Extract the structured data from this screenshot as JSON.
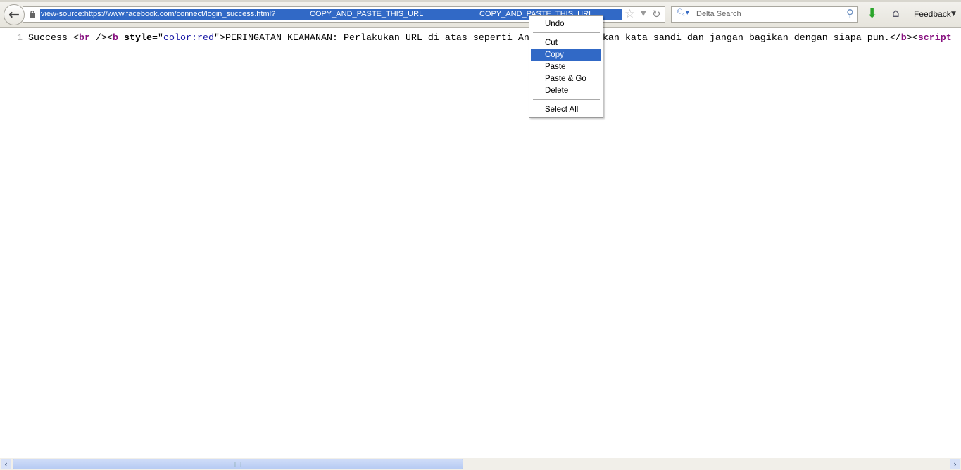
{
  "toolbar": {
    "url_prefix": "view-source:https://www.facebook.com/connect/login_success.html?",
    "url_token1": "COPY_AND_PASTE_THIS_URL",
    "url_token2": "COPY_AND_PASTE_THIS_URL",
    "search_placeholder": "Delta Search",
    "feedback_label": "Feedback"
  },
  "source": {
    "line_number": "1",
    "t1": "Success ",
    "t2": "<",
    "t3": "br",
    "t4": " />",
    "t5": "<",
    "t6": "b",
    "t7": " style",
    "t8": "=\"",
    "t9": "color:red",
    "t10": "\">",
    "t11": "PERINGATAN KEAMANAN: Perlakukan URL di atas seperti Anda memperlakukan kata sandi dan jangan bagikan dengan siapa pun.",
    "t12": "</",
    "t13": "b",
    "t14": "><",
    "t15": "script"
  },
  "context_menu": {
    "items": [
      "Undo",
      "Cut",
      "Copy",
      "Paste",
      "Paste & Go",
      "Delete",
      "Select All"
    ],
    "highlighted": "Copy"
  },
  "colors": {
    "selection": "#3169c6",
    "tag": "#881280",
    "attr_value": "#1a1aa6"
  }
}
